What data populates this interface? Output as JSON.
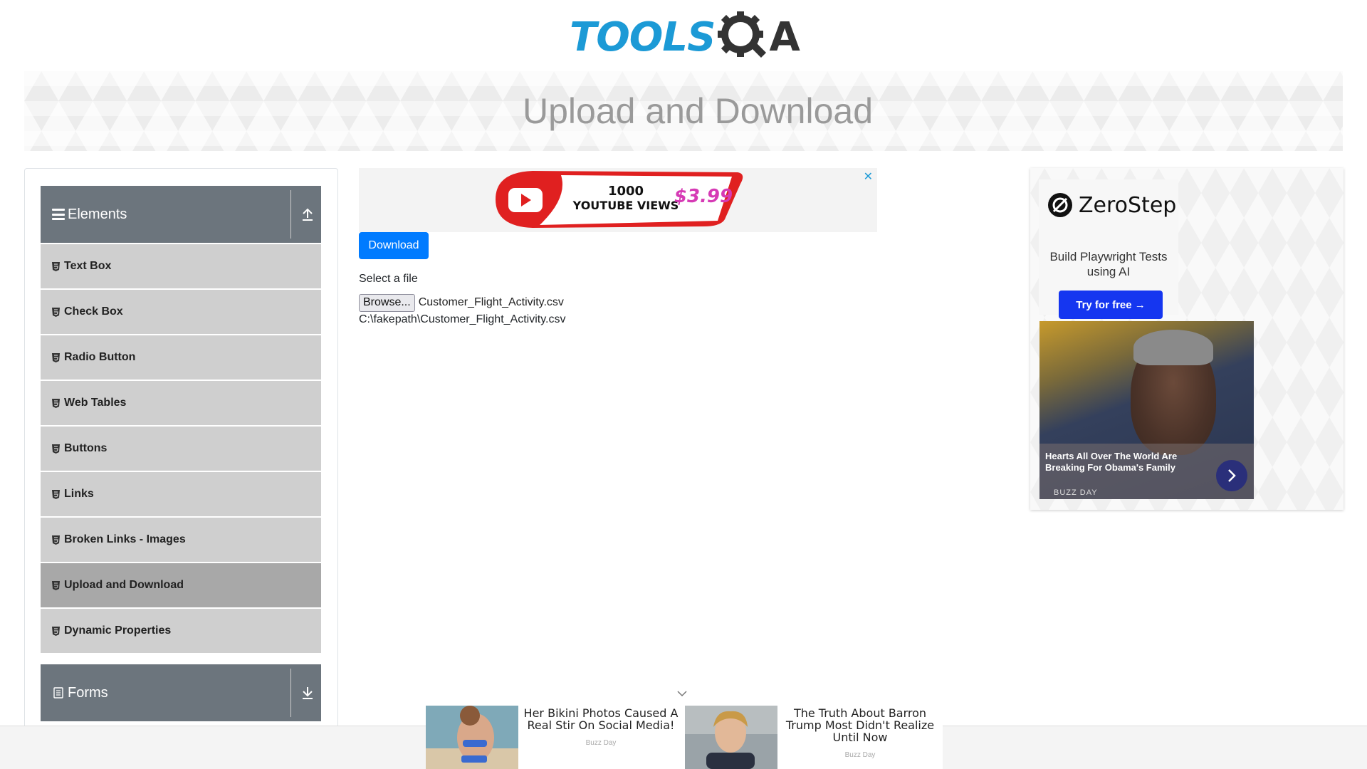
{
  "logo": {
    "part1": "TOOLS",
    "part2": "A"
  },
  "banner": {
    "title": "Upload and Download"
  },
  "sidebar": {
    "elements_group": {
      "title": "Elements"
    },
    "items": [
      {
        "label": "Text Box"
      },
      {
        "label": "Check Box"
      },
      {
        "label": "Radio Button"
      },
      {
        "label": "Web Tables"
      },
      {
        "label": "Buttons"
      },
      {
        "label": "Links"
      },
      {
        "label": "Broken Links - Images"
      },
      {
        "label": "Upload and Download",
        "active": true
      },
      {
        "label": "Dynamic Properties"
      }
    ],
    "forms_group": {
      "title": "Forms"
    }
  },
  "top_ad": {
    "close": "✕",
    "line1": "1000",
    "line2": "YOUTUBE VIEWS",
    "price": "$3.99"
  },
  "main": {
    "download_label": "Download",
    "select_label": "Select a file",
    "browse_label": "Browse...",
    "file_name": "Customer_Flight_Activity.csv",
    "uploaded_path": "C:\\fakepath\\Customer_Flight_Activity.csv"
  },
  "right_ad": {
    "brand": "ZeroStep",
    "tagline": "Build Playwright Tests using AI",
    "cta": "Try for free →",
    "news_title": "Hearts All Over The World Are Breaking For Obama's Family",
    "news_source": "BUZZ DAY"
  },
  "bottom_ad": {
    "items": [
      {
        "title": "Her Bikini Photos Caused A Real Stir On Social Media!",
        "source": "Buzz Day"
      },
      {
        "title": "The Truth About Barron Trump Most Didn't Realize Until Now",
        "source": "Buzz Day"
      }
    ]
  },
  "colors": {
    "primary": "#007bff",
    "sidebar_header": "#6c757d",
    "menu_item": "#cfcfcf",
    "menu_active": "#a8a8a8",
    "logo_blue": "#1c9ad6",
    "cta_blue": "#1536f0"
  }
}
